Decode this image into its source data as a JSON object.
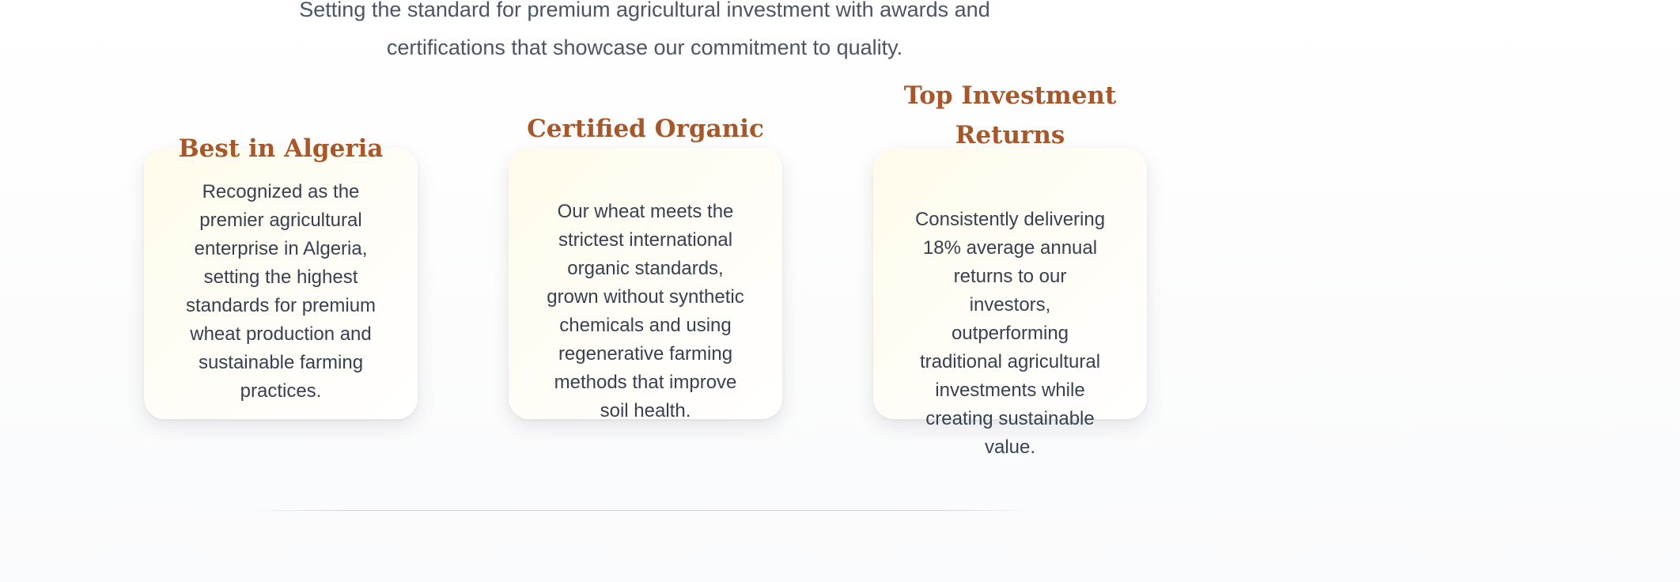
{
  "intro": {
    "text": "Setting the standard for premium agricultural investment with awards and certifications that showcase our commitment to quality."
  },
  "awards": [
    {
      "title": "Best in Algeria",
      "description": "Recognized as the premier agricultural enterprise in Algeria, setting the highest standards for premium wheat production and sustainable farming practices."
    },
    {
      "title": "Certified Organic",
      "description": "Our wheat meets the strictest international organic standards, grown without synthetic chemicals and using regenerative farming methods that improve soil health."
    },
    {
      "title": "Top Investment Returns",
      "description": "Consistently delivering 18% average annual returns to our investors, outperforming traditional agricultural investments while creating sustainable value."
    }
  ],
  "colors": {
    "title_accent": "#a6582a",
    "body_text": "#374151",
    "card_background": "#fffbeb"
  }
}
